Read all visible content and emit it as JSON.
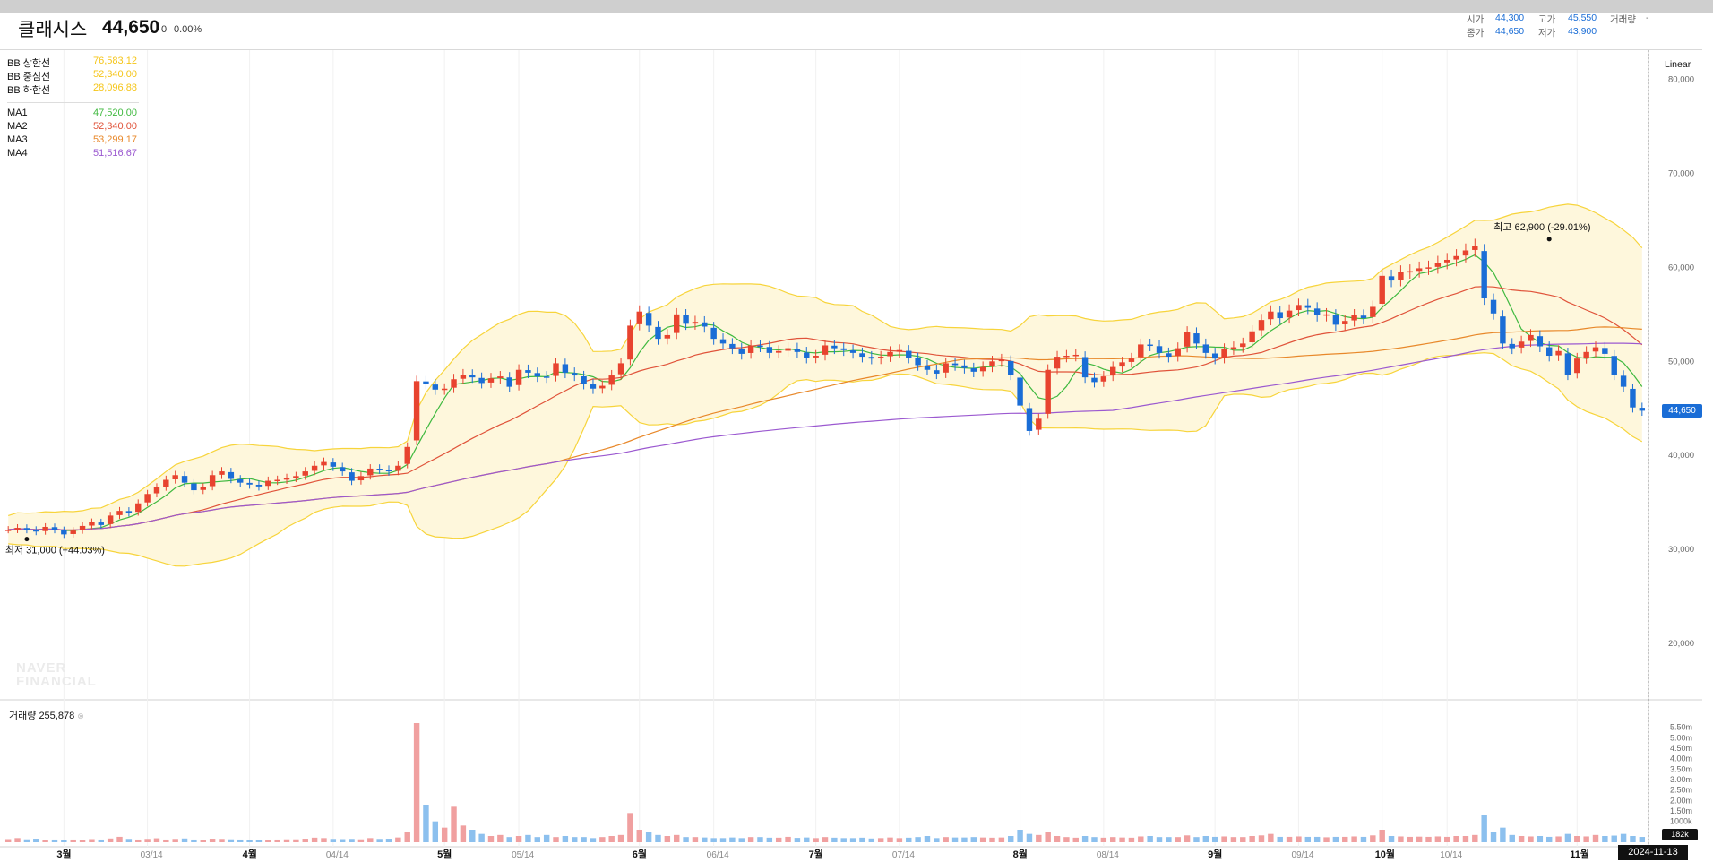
{
  "header": {
    "name": "클래시스",
    "price": "44,650",
    "change": "0",
    "change_rate": "0.00%"
  },
  "quote": {
    "open_label": "시가",
    "open": "44,300",
    "high_label": "고가",
    "high": "45,550",
    "volume_label": "거래량",
    "volume": "-",
    "close_label": "종가",
    "close": "44,650",
    "low_label": "저가",
    "low": "43,900"
  },
  "legend": {
    "bb": [
      {
        "label": "BB 상한선",
        "value": "76,583.12",
        "color": "#f5c518"
      },
      {
        "label": "BB 중심선",
        "value": "52,340.00",
        "color": "#f5c518"
      },
      {
        "label": "BB 하한선",
        "value": "28,096.88",
        "color": "#f5c518"
      }
    ],
    "ma": [
      {
        "label": "MA1",
        "value": "47,520.00",
        "color": "#3fb93f"
      },
      {
        "label": "MA2",
        "value": "52,340.00",
        "color": "#e0533a"
      },
      {
        "label": "MA3",
        "value": "53,299.17",
        "color": "#e8882a"
      },
      {
        "label": "MA4",
        "value": "51,516.67",
        "color": "#9b59d0"
      }
    ]
  },
  "scale_label": "Linear",
  "volume_panel": {
    "label": "거래량",
    "value": "255,878"
  },
  "watermark": [
    "NAVER",
    "FINANCIAL"
  ],
  "last_price_badge": "44,650",
  "last_volume_badge": "182k",
  "date_badge": "2024-11-13",
  "colors": {
    "up": "#e8432f",
    "down": "#1a6dd6",
    "bb_fill": "#fef7dc",
    "bb_line": "#f7d43b"
  },
  "chart_data": {
    "type": "candlestick",
    "y_ticks": [
      "80,000",
      "70,000",
      "60,000",
      "50,000",
      "40,000",
      "30,000",
      "20,000"
    ],
    "y_tick_values": [
      80000,
      70000,
      60000,
      50000,
      40000,
      30000,
      20000
    ],
    "ylim": [
      14000,
      83000
    ],
    "volume_ticks": [
      "5.50m",
      "5.00m",
      "4.50m",
      "4.00m",
      "3.50m",
      "3.00m",
      "2.50m",
      "2.00m",
      "1.50m",
      "1000k"
    ],
    "volume_tick_values": [
      5500000,
      5000000,
      4500000,
      4000000,
      3500000,
      3000000,
      2500000,
      2000000,
      1500000,
      1000000
    ],
    "x_labels": [
      {
        "label": "3월",
        "bold": true,
        "i": 6
      },
      {
        "label": "03/14",
        "bold": false,
        "i": 15
      },
      {
        "label": "4월",
        "bold": true,
        "i": 26
      },
      {
        "label": "04/14",
        "bold": false,
        "i": 35
      },
      {
        "label": "5월",
        "bold": true,
        "i": 47
      },
      {
        "label": "05/14",
        "bold": false,
        "i": 55
      },
      {
        "label": "6월",
        "bold": true,
        "i": 68
      },
      {
        "label": "06/14",
        "bold": false,
        "i": 76
      },
      {
        "label": "7월",
        "bold": true,
        "i": 87
      },
      {
        "label": "07/14",
        "bold": false,
        "i": 96
      },
      {
        "label": "8월",
        "bold": true,
        "i": 109
      },
      {
        "label": "08/14",
        "bold": false,
        "i": 118
      },
      {
        "label": "9월",
        "bold": true,
        "i": 130
      },
      {
        "label": "09/14",
        "bold": false,
        "i": 139
      },
      {
        "label": "10월",
        "bold": true,
        "i": 148
      },
      {
        "label": "10/14",
        "bold": false,
        "i": 155
      },
      {
        "label": "11월",
        "bold": true,
        "i": 169
      }
    ],
    "close": [
      32000,
      32200,
      32000,
      31800,
      32300,
      32000,
      31500,
      31900,
      32400,
      32800,
      32500,
      33500,
      34000,
      33800,
      34800,
      35800,
      36500,
      37300,
      37800,
      37000,
      36200,
      36500,
      37800,
      38200,
      37400,
      37000,
      36800,
      36600,
      37200,
      37300,
      37500,
      37700,
      38200,
      38800,
      39200,
      38700,
      38200,
      37200,
      37700,
      38500,
      38400,
      38200,
      38800,
      40800,
      47800,
      47500,
      46900,
      47000,
      48000,
      48500,
      48200,
      47600,
      48100,
      48300,
      47200,
      49000,
      48700,
      48300,
      48200,
      49700,
      48700,
      48400,
      47500,
      47000,
      47300,
      48400,
      49700,
      53700,
      55200,
      53700,
      52300,
      52700,
      54900,
      53900,
      54100,
      53600,
      52300,
      51800,
      51300,
      50700,
      51600,
      51500,
      50800,
      51000,
      51300,
      50900,
      50300,
      50500,
      51600,
      51300,
      51100,
      50800,
      50400,
      50200,
      50400,
      50900,
      51100,
      50300,
      49500,
      49000,
      48600,
      49700,
      49500,
      49200,
      48800,
      49300,
      49900,
      50100,
      48500,
      45200,
      42500,
      43800,
      49000,
      50400,
      50500,
      50600,
      48200,
      47700,
      48300,
      49300,
      49800,
      50200,
      51700,
      51600,
      50800,
      50400,
      51300,
      53000,
      51800,
      50800,
      50200,
      51200,
      51400,
      51800,
      53100,
      54300,
      55200,
      54500,
      55300,
      55900,
      55600,
      54800,
      54900,
      53800,
      54200,
      54800,
      54500,
      55700,
      59000,
      58500,
      59400,
      59500,
      59800,
      59900,
      60400,
      60700,
      61100,
      61700,
      62200,
      56600,
      55000,
      51800,
      51300,
      52000,
      52700,
      51500,
      50500,
      51000,
      48500,
      50200,
      50900,
      51400,
      50700,
      48500,
      47200,
      45000,
      44650
    ],
    "volume": [
      150000,
      200000,
      140000,
      170000,
      120000,
      130000,
      90000,
      130000,
      110000,
      150000,
      130000,
      180000,
      260000,
      160000,
      130000,
      160000,
      190000,
      130000,
      160000,
      180000,
      130000,
      110000,
      170000,
      160000,
      140000,
      130000,
      120000,
      110000,
      120000,
      130000,
      140000,
      140000,
      170000,
      220000,
      200000,
      160000,
      150000,
      160000,
      140000,
      200000,
      160000,
      170000,
      230000,
      500000,
      5700000,
      1800000,
      1000000,
      700000,
      1700000,
      800000,
      600000,
      400000,
      300000,
      350000,
      250000,
      300000,
      350000,
      250000,
      350000,
      250000,
      300000,
      250000,
      250000,
      200000,
      250000,
      300000,
      350000,
      1400000,
      600000,
      500000,
      350000,
      300000,
      350000,
      250000,
      250000,
      230000,
      200000,
      200000,
      230000,
      200000,
      250000,
      250000,
      220000,
      220000,
      260000,
      210000,
      230000,
      200000,
      250000,
      220000,
      200000,
      200000,
      220000,
      180000,
      200000,
      230000,
      200000,
      220000,
      250000,
      300000,
      200000,
      250000,
      230000,
      230000,
      250000,
      230000,
      220000,
      230000,
      300000,
      600000,
      400000,
      350000,
      500000,
      300000,
      250000,
      220000,
      300000,
      250000,
      220000,
      250000,
      230000,
      220000,
      280000,
      300000,
      250000,
      250000,
      250000,
      330000,
      250000,
      300000,
      260000,
      280000,
      250000,
      250000,
      300000,
      330000,
      400000,
      260000,
      260000,
      280000,
      260000,
      260000,
      240000,
      260000,
      260000,
      280000,
      260000,
      330000,
      600000,
      300000,
      280000,
      260000,
      270000,
      260000,
      280000,
      260000,
      300000,
      300000,
      350000,
      1300000,
      500000,
      700000,
      350000,
      300000,
      280000,
      300000,
      260000,
      280000,
      400000,
      300000,
      280000,
      350000,
      300000,
      320000,
      400000,
      300000,
      255878
    ],
    "annotations": [
      {
        "label": "최고",
        "value": "62,900 (-29.01%)",
        "price": 62900,
        "i": 166
      },
      {
        "label": "최저",
        "value": "31,000 (+44.03%)",
        "price": 31000,
        "i": 2
      }
    ]
  }
}
